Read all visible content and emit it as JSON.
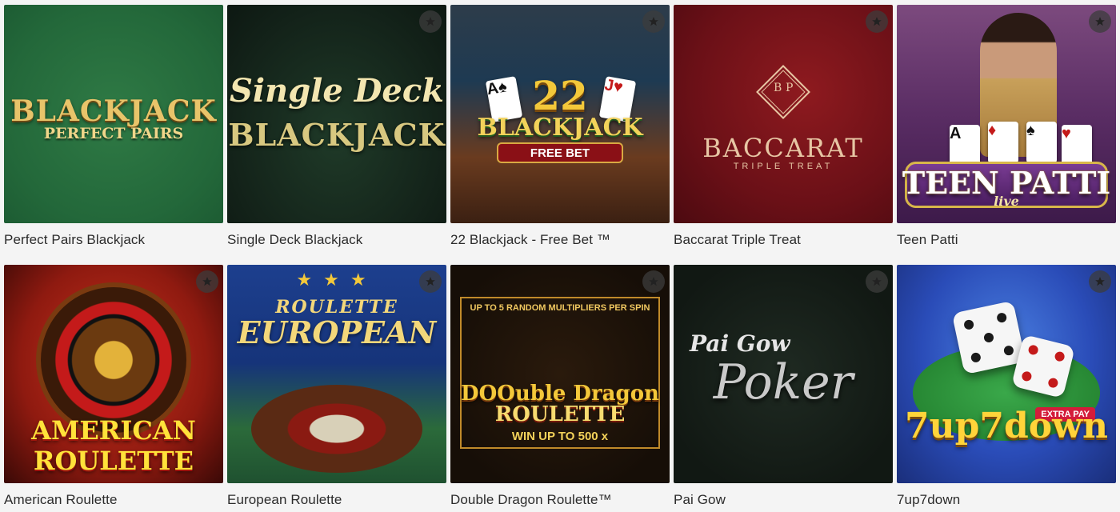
{
  "games": [
    {
      "label": "Perfect Pairs Blackjack",
      "art": [
        "BLACKJACK",
        "PERFECT PAIRS"
      ]
    },
    {
      "label": "Single Deck Blackjack",
      "art": [
        "Single Deck",
        "BLACKJACK"
      ]
    },
    {
      "label": "22 Blackjack - Free Bet ™",
      "art": [
        "22",
        "BLACKJACK",
        "FREE BET"
      ]
    },
    {
      "label": "Baccarat Triple Treat",
      "art": [
        "BACCARAT",
        "TRIPLE TREAT"
      ]
    },
    {
      "label": "Teen Patti",
      "art": [
        "TEEN PATTI",
        "live"
      ]
    },
    {
      "label": "American Roulette",
      "art": [
        "AMERICAN",
        "ROULETTE"
      ]
    },
    {
      "label": "European Roulette",
      "art": [
        "ROULETTE",
        "EUROPEAN"
      ]
    },
    {
      "label": "Double Dragon Roulette™",
      "art": [
        "UP TO 5 RANDOM MULTIPLIERS PER SPIN",
        "DOOuble Dragon",
        "ROULETTE",
        "WIN UP TO 500 x"
      ]
    },
    {
      "label": "Pai Gow",
      "art": [
        "Pai Gow",
        "Poker"
      ]
    },
    {
      "label": "7up7down",
      "art": [
        "7up7down",
        "EXTRA PAY"
      ]
    }
  ],
  "icons": {
    "favorite": "star-icon"
  }
}
